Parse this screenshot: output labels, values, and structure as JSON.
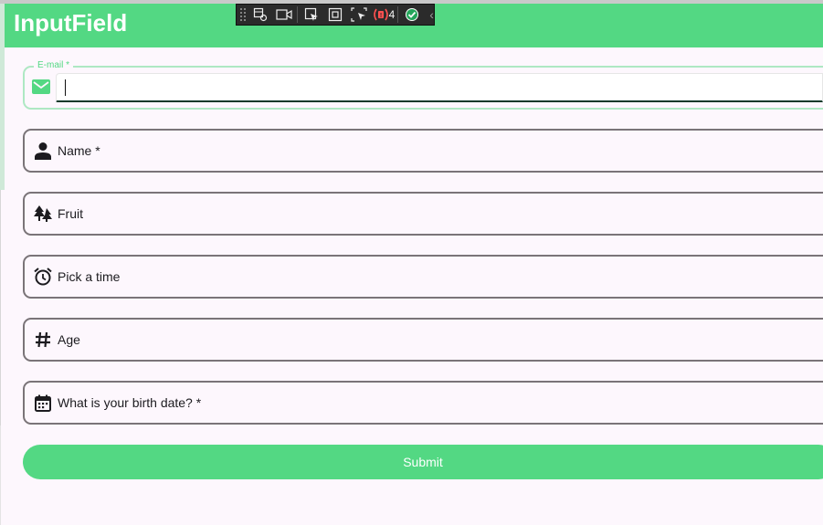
{
  "app": {
    "title": "InputField"
  },
  "devtools": {
    "badge_count": "4"
  },
  "form": {
    "email": {
      "legend": "E-mail *",
      "value": "",
      "icon": "envelope-icon"
    },
    "name": {
      "label": "Name *",
      "icon": "person-icon"
    },
    "fruit": {
      "label": "Fruit",
      "icon": "forest-icon"
    },
    "time": {
      "label": "Pick a time",
      "icon": "alarm-clock-icon"
    },
    "age": {
      "label": "Age",
      "icon": "hash-icon"
    },
    "birth_date": {
      "label": "What is your birth date? *",
      "icon": "calendar-icon"
    },
    "submit_label": "Submit"
  },
  "colors": {
    "accent": "#53d883",
    "field_border": "#7a7478",
    "background": "#fdf7fd",
    "focus_underline": "#0c3a2a"
  }
}
